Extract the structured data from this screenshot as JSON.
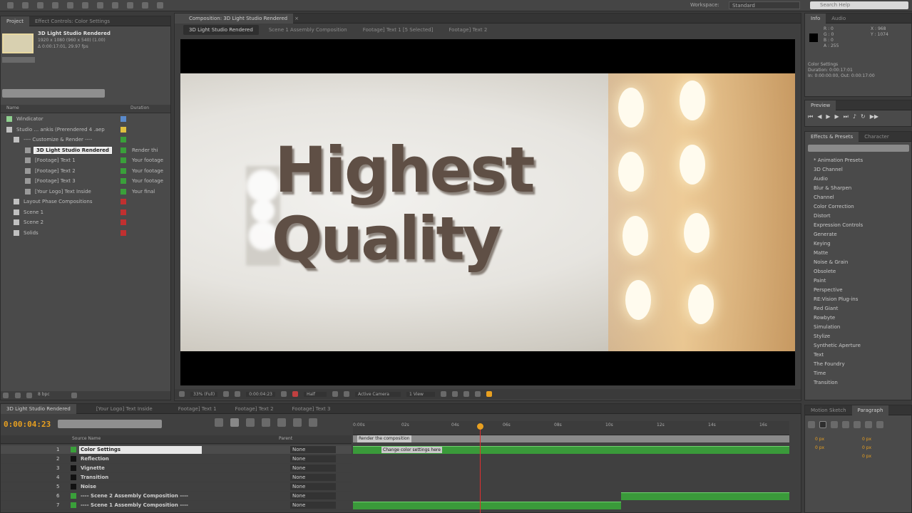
{
  "workspace": {
    "label": "Workspace:",
    "value": "Standard"
  },
  "search_help": "Search Help",
  "project_panel": {
    "tabs": [
      "Project",
      "Effect Controls: Color Settings"
    ],
    "selected_comp": "3D Light Studio Rendered",
    "comp_info": [
      "1920 x 1080  (960 x 540) (1.00)",
      "Δ 0:00:17:01, 29.97 fps"
    ],
    "col_name": "Name",
    "col_duration": "Duration",
    "items": [
      {
        "name": "Windicator",
        "dur": "",
        "color": "#5a8acb"
      },
      {
        "name": "Studio ... ankis (Prerendered 4 .aep",
        "dur": "",
        "color": "#e0c040"
      },
      {
        "name": "---- Customize & Render ----",
        "dur": "",
        "color": "#3aa03a"
      },
      {
        "name": "3D Light Studio Rendered",
        "dur": "Render thi",
        "color": "#3aa03a"
      },
      {
        "name": "[Footage] Text 1",
        "dur": "Your footage",
        "color": "#3aa03a"
      },
      {
        "name": "[Footage] Text 2",
        "dur": "Your footage",
        "color": "#3aa03a"
      },
      {
        "name": "[Footage] Text 3",
        "dur": "Your footage",
        "color": "#3aa03a"
      },
      {
        "name": "[Your Logo] Text Inside",
        "dur": "Your final",
        "color": "#3aa03a"
      },
      {
        "name": "Layout Phase Compositions",
        "dur": "",
        "color": "#c03030"
      },
      {
        "name": "Scene 1",
        "dur": "",
        "color": "#c03030"
      },
      {
        "name": "Scene 2",
        "dur": "",
        "color": "#c03030"
      },
      {
        "name": "Solids",
        "dur": "",
        "color": "#c03030"
      }
    ],
    "bpc": "8 bpc"
  },
  "composition_panel": {
    "tab": "Composition: 3D Light Studio Rendered",
    "sub_tabs": [
      "3D Light Studio Rendered",
      "Scene 1 Assembly Composition",
      "Footage] Text 1 [5 Selected]",
      "Footage] Text 2"
    ],
    "viewer_text": [
      "Highest",
      "Quality"
    ],
    "footer": {
      "zoom": "33% (Full)",
      "time": "0:00:04:23",
      "resolution": "Half",
      "camera": "Active Camera",
      "views": "1 View"
    }
  },
  "info_panel": {
    "tabs": [
      "Info",
      "Audio"
    ],
    "rgb": [
      "R : 0",
      "G : 0",
      "B : 0",
      "A : 255"
    ],
    "xy": [
      "X : 968",
      "Y : 1074"
    ],
    "details": [
      "Color Settings",
      "Duration: 0:00:17:01",
      "In: 0:00:00:00, Out: 0:00:17:00"
    ]
  },
  "preview_panel": {
    "tab": "Preview"
  },
  "effects_panel": {
    "tabs": [
      "Effects & Presets",
      "Character"
    ],
    "items": [
      "* Animation Presets",
      "3D Channel",
      "Audio",
      "Blur & Sharpen",
      "Channel",
      "Color Correction",
      "Distort",
      "Expression Controls",
      "Generate",
      "Keying",
      "Matte",
      "Noise & Grain",
      "Obsolete",
      "Paint",
      "Perspective",
      "RE:Vision Plug-ins",
      "Red Giant",
      "Rowbyte",
      "Simulation",
      "Stylize",
      "Synthetic Aperture",
      "Text",
      "The Foundry",
      "Time",
      "Transition"
    ]
  },
  "paragraph_panel": {
    "tabs": [
      "Motion Sketch",
      "Paragraph"
    ],
    "values": [
      "0 px",
      "0 px",
      "0 px",
      "0 px",
      "0 px"
    ]
  },
  "timeline": {
    "tabs": [
      "3D Light Studio Rendered",
      "[Your Logo] Text Inside",
      "Footage] Text 1",
      "Footage] Text 2",
      "Footage] Text 3"
    ],
    "timecode": "0:00:04:23",
    "col_source": "Source Name",
    "col_parent": "Parent",
    "ruler": [
      "0:00s",
      "02s",
      "04s",
      "06s",
      "08s",
      "10s",
      "12s",
      "14s",
      "16s"
    ],
    "marker": "Render the composition",
    "layers": [
      {
        "num": "1",
        "name": "Color Settings",
        "parent": "None",
        "swatch": "#3aa03a",
        "bar_label": "Change color settings here"
      },
      {
        "num": "2",
        "name": "Reflection",
        "parent": "None",
        "swatch": "#111111",
        "bar_label": ""
      },
      {
        "num": "3",
        "name": "Vignette",
        "parent": "None",
        "swatch": "#111111",
        "bar_label": ""
      },
      {
        "num": "4",
        "name": "Transition",
        "parent": "None",
        "swatch": "#111111",
        "bar_label": ""
      },
      {
        "num": "5",
        "name": "Noise",
        "parent": "None",
        "swatch": "#111111",
        "bar_label": ""
      },
      {
        "num": "6",
        "name": "---- Scene 2 Assembly Composition ----",
        "parent": "None",
        "swatch": "#3aa03a",
        "bar_label": ""
      },
      {
        "num": "7",
        "name": "---- Scene 1 Assembly Composition ----",
        "parent": "None",
        "swatch": "#3aa03a",
        "bar_label": ""
      }
    ]
  },
  "colors": {
    "accent_orange": "#e8a020",
    "playhead_red": "#e03030",
    "layer_green": "#3a9a3a"
  }
}
